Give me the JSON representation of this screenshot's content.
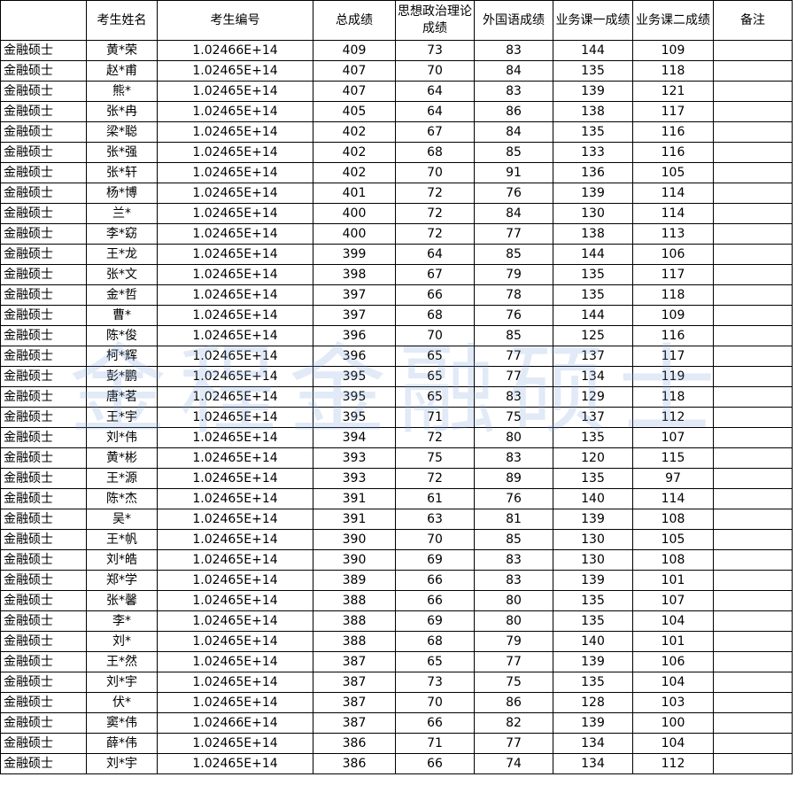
{
  "headers": [
    "",
    "考生姓名",
    "考生编号",
    "总成绩",
    "思想政治理论成绩",
    "外国语成绩",
    "业务课一成绩",
    "业务课二成绩",
    "备注"
  ],
  "rows": [
    [
      "金融硕士",
      "黄*荣",
      "1.02466E+14",
      "409",
      "73",
      "83",
      "144",
      "109",
      ""
    ],
    [
      "金融硕士",
      "赵*甫",
      "1.02465E+14",
      "407",
      "70",
      "84",
      "135",
      "118",
      ""
    ],
    [
      "金融硕士",
      "熊*",
      "1.02465E+14",
      "407",
      "64",
      "83",
      "139",
      "121",
      ""
    ],
    [
      "金融硕士",
      "张*冉",
      "1.02465E+14",
      "405",
      "64",
      "86",
      "138",
      "117",
      ""
    ],
    [
      "金融硕士",
      "梁*聪",
      "1.02465E+14",
      "402",
      "67",
      "84",
      "135",
      "116",
      ""
    ],
    [
      "金融硕士",
      "张*强",
      "1.02465E+14",
      "402",
      "68",
      "85",
      "133",
      "116",
      ""
    ],
    [
      "金融硕士",
      "张*轩",
      "1.02465E+14",
      "402",
      "70",
      "91",
      "136",
      "105",
      ""
    ],
    [
      "金融硕士",
      "杨*博",
      "1.02465E+14",
      "401",
      "72",
      "76",
      "139",
      "114",
      ""
    ],
    [
      "金融硕士",
      "兰*",
      "1.02465E+14",
      "400",
      "72",
      "84",
      "130",
      "114",
      ""
    ],
    [
      "金融硕士",
      "李*窈",
      "1.02465E+14",
      "400",
      "72",
      "77",
      "138",
      "113",
      ""
    ],
    [
      "金融硕士",
      "王*龙",
      "1.02465E+14",
      "399",
      "64",
      "85",
      "144",
      "106",
      ""
    ],
    [
      "金融硕士",
      "张*文",
      "1.02465E+14",
      "398",
      "67",
      "79",
      "135",
      "117",
      ""
    ],
    [
      "金融硕士",
      "金*哲",
      "1.02465E+14",
      "397",
      "66",
      "78",
      "135",
      "118",
      ""
    ],
    [
      "金融硕士",
      "曹*",
      "1.02465E+14",
      "397",
      "68",
      "76",
      "144",
      "109",
      ""
    ],
    [
      "金融硕士",
      "陈*俊",
      "1.02465E+14",
      "396",
      "70",
      "85",
      "125",
      "116",
      ""
    ],
    [
      "金融硕士",
      "柯*辉",
      "1.02465E+14",
      "396",
      "65",
      "77",
      "137",
      "117",
      ""
    ],
    [
      "金融硕士",
      "彭*鹏",
      "1.02465E+14",
      "395",
      "65",
      "77",
      "134",
      "119",
      ""
    ],
    [
      "金融硕士",
      "唐*茗",
      "1.02465E+14",
      "395",
      "65",
      "83",
      "129",
      "118",
      ""
    ],
    [
      "金融硕士",
      "王*宇",
      "1.02465E+14",
      "395",
      "71",
      "75",
      "137",
      "112",
      ""
    ],
    [
      "金融硕士",
      "刘*伟",
      "1.02465E+14",
      "394",
      "72",
      "80",
      "135",
      "107",
      ""
    ],
    [
      "金融硕士",
      "黄*彬",
      "1.02465E+14",
      "393",
      "75",
      "83",
      "120",
      "115",
      ""
    ],
    [
      "金融硕士",
      "王*源",
      "1.02465E+14",
      "393",
      "72",
      "89",
      "135",
      "97",
      ""
    ],
    [
      "金融硕士",
      "陈*杰",
      "1.02465E+14",
      "391",
      "61",
      "76",
      "140",
      "114",
      ""
    ],
    [
      "金融硕士",
      "吴*",
      "1.02465E+14",
      "391",
      "63",
      "81",
      "139",
      "108",
      ""
    ],
    [
      "金融硕士",
      "王*帆",
      "1.02465E+14",
      "390",
      "70",
      "85",
      "130",
      "105",
      ""
    ],
    [
      "金融硕士",
      "刘*皓",
      "1.02465E+14",
      "390",
      "69",
      "83",
      "130",
      "108",
      ""
    ],
    [
      "金融硕士",
      "郑*学",
      "1.02465E+14",
      "389",
      "66",
      "83",
      "139",
      "101",
      ""
    ],
    [
      "金融硕士",
      "张*馨",
      "1.02465E+14",
      "388",
      "66",
      "80",
      "135",
      "107",
      ""
    ],
    [
      "金融硕士",
      "李*",
      "1.02465E+14",
      "388",
      "69",
      "80",
      "135",
      "104",
      ""
    ],
    [
      "金融硕士",
      "刘*",
      "1.02465E+14",
      "388",
      "68",
      "79",
      "140",
      "101",
      ""
    ],
    [
      "金融硕士",
      "王*然",
      "1.02465E+14",
      "387",
      "65",
      "77",
      "139",
      "106",
      ""
    ],
    [
      "金融硕士",
      "刘*宇",
      "1.02465E+14",
      "387",
      "73",
      "75",
      "135",
      "104",
      ""
    ],
    [
      "金融硕士",
      "伏*",
      "1.02465E+14",
      "387",
      "70",
      "86",
      "128",
      "103",
      ""
    ],
    [
      "金融硕士",
      "窦*伟",
      "1.02466E+14",
      "387",
      "66",
      "82",
      "139",
      "100",
      ""
    ],
    [
      "金融硕士",
      "薛*伟",
      "1.02465E+14",
      "386",
      "71",
      "77",
      "134",
      "104",
      ""
    ],
    [
      "金融硕士",
      "刘*宇",
      "1.02465E+14",
      "386",
      "66",
      "74",
      "134",
      "112",
      ""
    ]
  ],
  "watermark": "金程金融硕士"
}
